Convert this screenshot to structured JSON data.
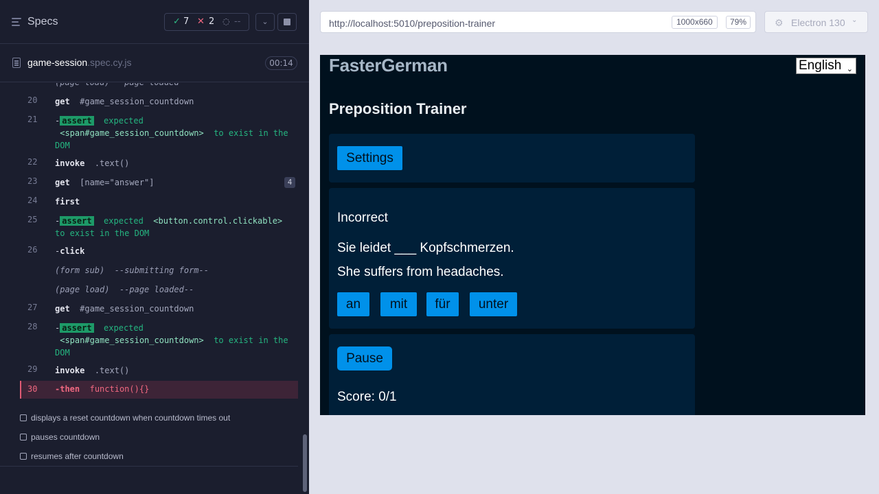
{
  "reporter": {
    "title": "Specs",
    "stats": {
      "passed": "7",
      "failed": "2",
      "pending": "--"
    },
    "spec_file": {
      "name": "game-session",
      "ext": ".spec.cy.js",
      "duration": "00:14"
    },
    "commands": {
      "partial_line": "(page load)  --page loaded--",
      "c20": {
        "num": "20",
        "kw": "get",
        "arg": "#game_session_countdown"
      },
      "c21": {
        "num": "21",
        "badge": "assert",
        "msg_a": "expected",
        "el": "<span#game_session_countdown>",
        "msg_b": "to exist in the DOM"
      },
      "c22": {
        "num": "22",
        "kw": "invoke",
        "arg": ".text()"
      },
      "c23": {
        "num": "23",
        "kw": "get",
        "arg": "[name=\"answer\"]",
        "count": "4"
      },
      "c24": {
        "num": "24",
        "kw": "first"
      },
      "c25": {
        "num": "25",
        "badge": "assert",
        "msg_a": "expected",
        "el": "<button.control.clickable>",
        "msg_b": "to exist in the DOM"
      },
      "c26": {
        "num": "26",
        "kw": "click"
      },
      "form_sub": {
        "label": "(form sub)",
        "msg": "--submitting form--"
      },
      "page_load": {
        "label": "(page load)",
        "msg": "--page loaded--"
      },
      "c27": {
        "num": "27",
        "kw": "get",
        "arg": "#game_session_countdown"
      },
      "c28": {
        "num": "28",
        "badge": "assert",
        "msg_a": "expected",
        "el": "<span#game_session_countdown>",
        "msg_b": "to exist in the DOM"
      },
      "c29": {
        "num": "29",
        "kw": "invoke",
        "arg": ".text()"
      },
      "c30": {
        "num": "30",
        "kw": "then",
        "arg": "function(){}"
      }
    },
    "tests": [
      "displays a reset countdown when countdown times out",
      "pauses countdown",
      "resumes after countdown"
    ]
  },
  "browser": {
    "url": "http://localhost:5010/preposition-trainer",
    "viewport": "1000x660",
    "zoom": "79%",
    "browser_name": "Electron 130"
  },
  "app": {
    "logo": "FasterGerman",
    "language": "English",
    "page_title": "Preposition Trainer",
    "settings_label": "Settings",
    "result": "Incorrect",
    "sentence_de": "Sie leidet ___ Kopfschmerzen.",
    "sentence_en": "She suffers from headaches.",
    "answers": [
      "an",
      "mit",
      "für",
      "unter"
    ],
    "pause_label": "Pause",
    "score": "Score: 0/1"
  },
  "colors": {
    "reporter_bg": "#1b1e2e",
    "pass": "#2fb984",
    "fail": "#f06880",
    "app_bg": "#00111e",
    "card_bg": "#001f38",
    "button_blue": "#0091ea"
  }
}
